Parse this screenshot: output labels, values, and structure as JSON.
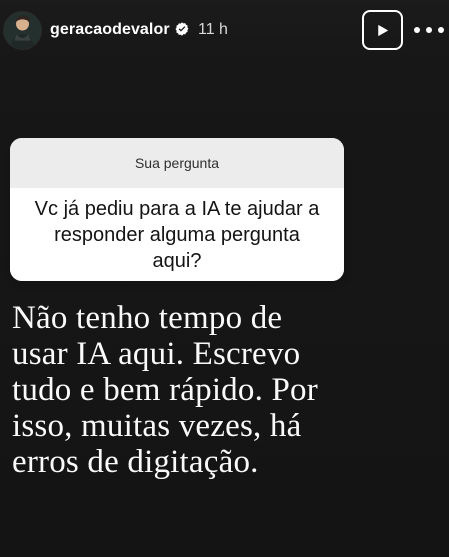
{
  "header": {
    "username": "geracaodevalor",
    "time": "11 h",
    "avatar_icon": "profile-photo-icon",
    "verified_icon": "verified-badge-icon",
    "play_icon": "play-icon",
    "more_icon": "more-horizontal-icon"
  },
  "question": {
    "label": "Sua pergunta",
    "text": "Vc já pediu para a IA te ajudar a responder alguma pergunta aqui?"
  },
  "answer": {
    "lines": [
      "Não tenho tempo de",
      "usar IA aqui. Escrevo",
      "tudo e bem rápido. Por",
      "isso, muitas vezes, há",
      "erros de digitação."
    ]
  },
  "colors": {
    "background": "#141414",
    "header_text": "#ffffff",
    "card_head": "#ececec",
    "card_body": "#ffffff",
    "card_text": "#141414",
    "answer_text": "#fafafa"
  }
}
